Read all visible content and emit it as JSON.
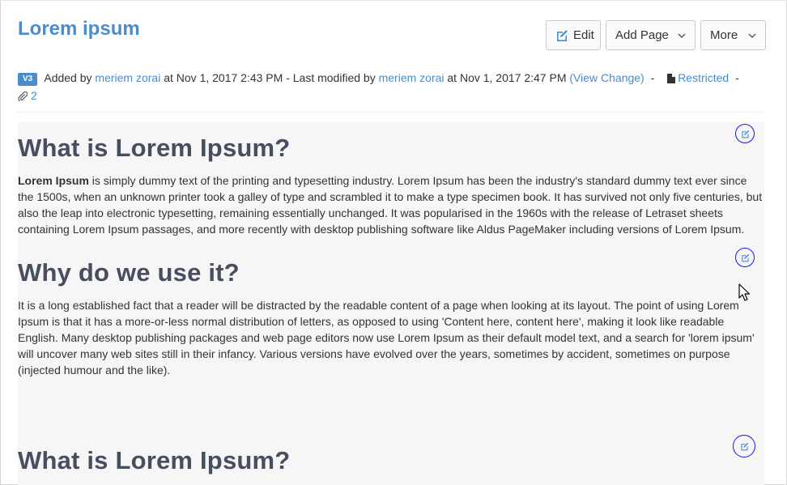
{
  "page": {
    "title": "Lorem ipsum"
  },
  "actions": {
    "edit_label": "Edit",
    "add_page_label": "Add Page",
    "more_label": "More"
  },
  "meta": {
    "version": "V3",
    "added_by_prefix": "Added by",
    "author": "meriem zorai",
    "added_at": "at Nov 1, 2017 2:43 PM - Last modified by",
    "modifier": "meriem zorai",
    "modified_at": "at Nov 1, 2017 2:47 PM",
    "view_change": "(View Change)",
    "dash1": "-",
    "restriction": "Restricted",
    "dash2": "-",
    "attachments": "2"
  },
  "content": {
    "section1": {
      "heading": "What is Lorem Ipsum?",
      "bold_start": "Lorem Ipsum",
      "body": " is simply dummy text of the printing and typesetting industry. Lorem Ipsum has been the industry's standard dummy text ever since the 1500s, when an unknown printer took a galley of type and scrambled it to make a type specimen book. It has survived not only five centuries, but also the leap into electronic typesetting, remaining essentially unchanged. It was popularised in the 1960s with the release of Letraset sheets containing Lorem Ipsum passages, and more recently with desktop publishing software like Aldus PageMaker including versions of Lorem Ipsum."
    },
    "section2": {
      "heading": "Why do we use it?",
      "body": "It is a long established fact that a reader will be distracted by the readable content of a page when looking at its layout. The point of using Lorem Ipsum is that it has a more-or-less normal distribution of letters, as opposed to using 'Content here, content here', making it look like readable English. Many desktop publishing packages and web page editors now use Lorem Ipsum as their default model text, and a search for 'lorem ipsum' will uncover many web sites still in their infancy. Various versions have evolved over the years, sometimes by accident, sometimes on purpose (injected humour and the like)."
    },
    "section3": {
      "heading": "What is Lorem Ipsum?"
    }
  },
  "colors": {
    "accent": "#4a8ccc",
    "heading": "#474e60",
    "edit_ring": "#1a1ad6"
  },
  "icons": [
    "edit-icon",
    "chevron-down-icon",
    "document-icon",
    "paperclip-icon",
    "section-edit-icon",
    "mouse-cursor-icon"
  ]
}
